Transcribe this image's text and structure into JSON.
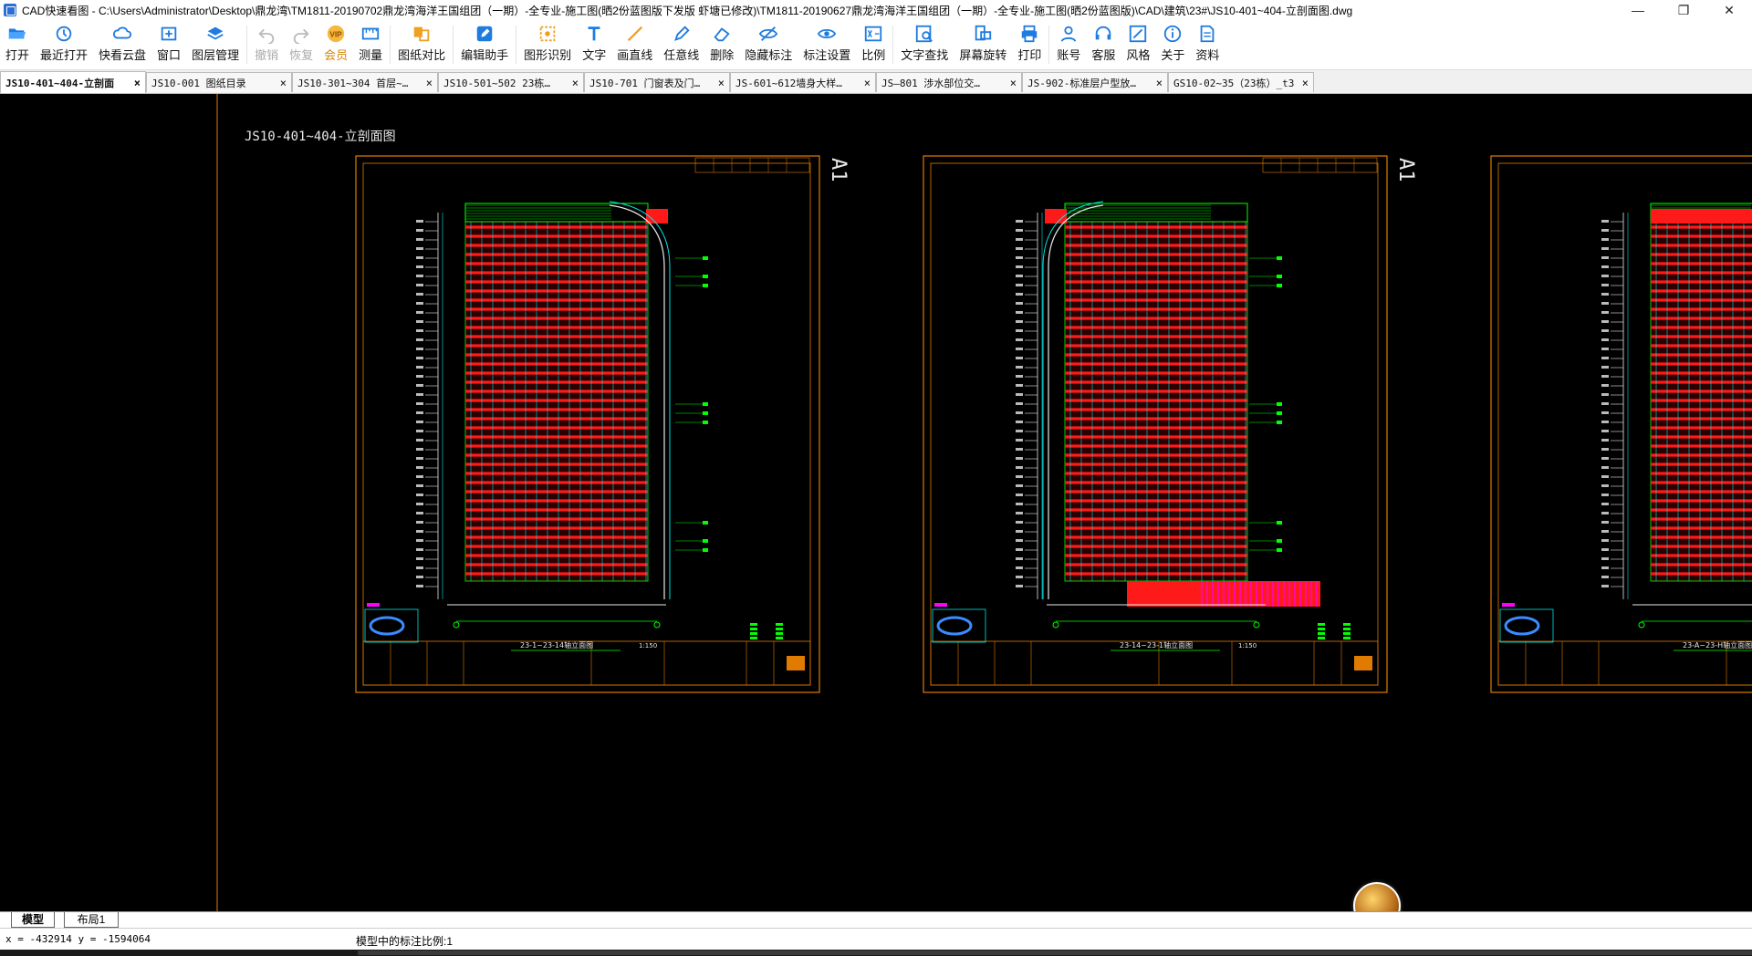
{
  "window": {
    "title": "CAD快速看图 - C:\\Users\\Administrator\\Desktop\\鼎龙湾\\TM1811-20190702鼎龙湾海洋王国组团（一期）-全专业-施工图(晒2份蓝图版下发版 虾塘已修改)\\TM1811-20190627鼎龙湾海洋王国组团（一期）-全专业-施工图(晒2份蓝图版)\\CAD\\建筑\\23#\\JS10-401~404-立剖面图.dwg",
    "minimize": "—",
    "maximize": "❐",
    "close": "✕"
  },
  "toolbar": {
    "items": [
      {
        "label": "打开",
        "icon": "folder-open-icon",
        "disabled": false
      },
      {
        "label": "最近打开",
        "icon": "history-icon",
        "disabled": false
      },
      {
        "label": "快看云盘",
        "icon": "cloud-icon",
        "disabled": false
      },
      {
        "label": "窗口",
        "icon": "window-icon",
        "disabled": false
      },
      {
        "label": "图层管理",
        "icon": "layers-icon",
        "disabled": false
      },
      {
        "label": "撤销",
        "icon": "undo-icon",
        "disabled": true
      },
      {
        "label": "恢复",
        "icon": "redo-icon",
        "disabled": true
      },
      {
        "label": "会员",
        "icon": "vip-icon",
        "disabled": false
      },
      {
        "label": "测量",
        "icon": "ruler-icon",
        "disabled": false
      },
      {
        "label": "图纸对比",
        "icon": "compare-icon",
        "disabled": false
      },
      {
        "label": "编辑助手",
        "icon": "edit-assistant-icon",
        "disabled": false
      },
      {
        "label": "图形识别",
        "icon": "shape-recognition-icon",
        "disabled": false
      },
      {
        "label": "文字",
        "icon": "text-icon",
        "disabled": false
      },
      {
        "label": "画直线",
        "icon": "line-icon",
        "disabled": false
      },
      {
        "label": "任意线",
        "icon": "pencil-icon",
        "disabled": false
      },
      {
        "label": "删除",
        "icon": "eraser-icon",
        "disabled": false
      },
      {
        "label": "隐藏标注",
        "icon": "eye-hide-icon",
        "disabled": false
      },
      {
        "label": "标注设置",
        "icon": "annotation-settings-icon",
        "disabled": false
      },
      {
        "label": "比例",
        "icon": "scale-icon",
        "disabled": false
      },
      {
        "label": "文字查找",
        "icon": "text-search-icon",
        "disabled": false
      },
      {
        "label": "屏幕旋转",
        "icon": "rotate-screen-icon",
        "disabled": false
      },
      {
        "label": "打印",
        "icon": "printer-icon",
        "disabled": false
      },
      {
        "label": "账号",
        "icon": "user-icon",
        "disabled": false
      },
      {
        "label": "客服",
        "icon": "headset-icon",
        "disabled": false
      },
      {
        "label": "风格",
        "icon": "style-icon",
        "disabled": false
      },
      {
        "label": "关于",
        "icon": "info-icon",
        "disabled": false
      },
      {
        "label": "资料",
        "icon": "document-icon",
        "disabled": false
      }
    ]
  },
  "tabs": [
    {
      "label": "JS10-401~404-立剖面",
      "active": true
    },
    {
      "label": "JS10-001 图纸目录",
      "active": false
    },
    {
      "label": "JS10-301~304 首层~…",
      "active": false
    },
    {
      "label": "JS10-501~502  23栋…",
      "active": false
    },
    {
      "label": "JS10-701 门窗表及门…",
      "active": false
    },
    {
      "label": "JS-601~612墙身大样…",
      "active": false
    },
    {
      "label": "JS—801 涉水部位交…",
      "active": false
    },
    {
      "label": "JS-902-标准层户型放…",
      "active": false
    },
    {
      "label": "GS10-02~35（23栋）_t3",
      "active": false
    }
  ],
  "drawing": {
    "title": "JS10-401~404-立剖面图",
    "sheet_mark": "A1",
    "sheets": [
      {
        "caption": "23-1~23-14轴立面图",
        "scale": "1:150"
      },
      {
        "caption": "23-14~23-1轴立面图",
        "scale": "1:150"
      },
      {
        "caption": "23-A~23-H轴立面图",
        "scale": ""
      }
    ],
    "colors": {
      "frame": "#e07b00",
      "grid": "#00e5e5",
      "facade": "#ff1a1a",
      "annot": "#00ff00",
      "magenta": "#ff00ff",
      "white": "#e8e8e8",
      "blue": "#3a8cff"
    }
  },
  "layout_tabs": [
    {
      "label": "模型",
      "active": true
    },
    {
      "label": "布局1",
      "active": false
    }
  ],
  "status": {
    "coords": "x = -432914  y = -1594064",
    "scale_text": "模型中的标注比例:1"
  }
}
